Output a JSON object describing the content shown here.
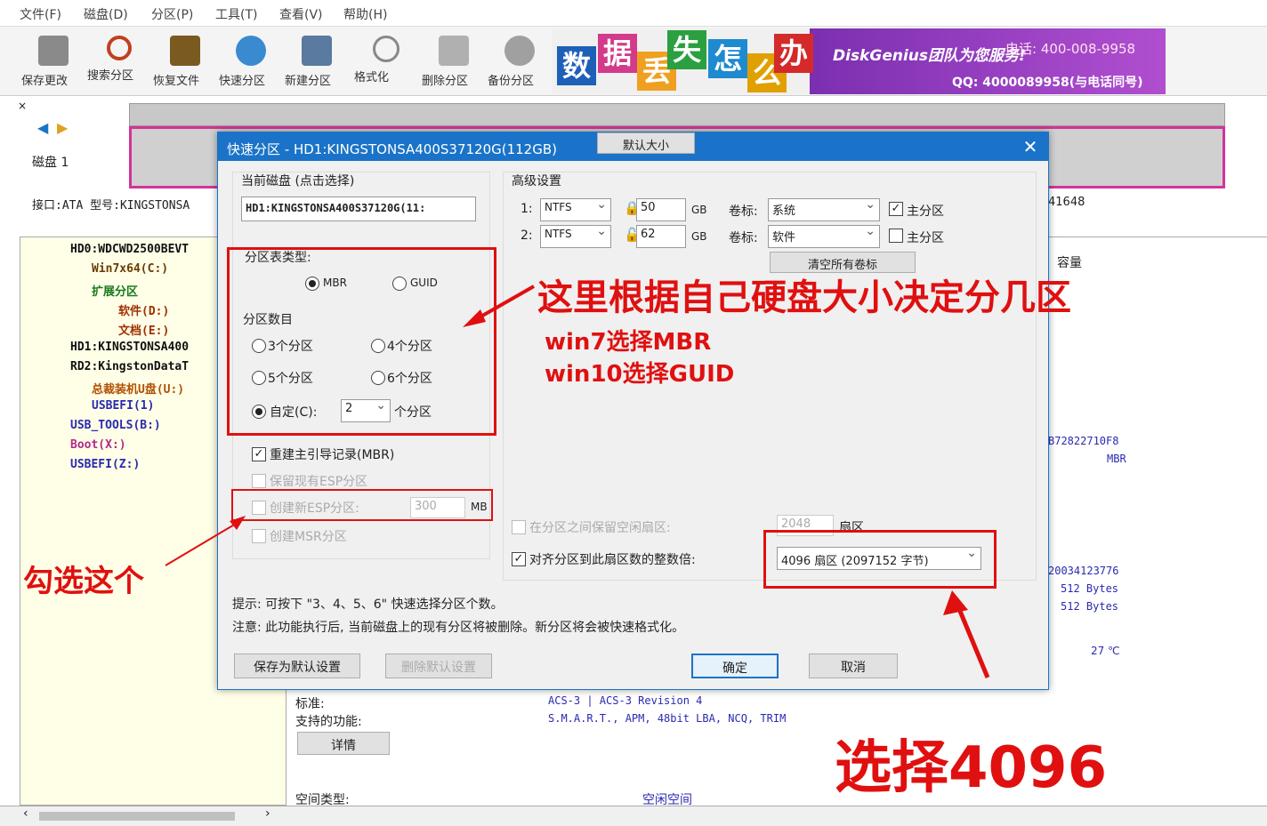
{
  "menu": [
    "文件(F)",
    "磁盘(D)",
    "分区(P)",
    "工具(T)",
    "查看(V)",
    "帮助(H)"
  ],
  "toolbar": [
    {
      "label": "保存更改",
      "icon": "save-icon"
    },
    {
      "label": "搜索分区",
      "icon": "search-icon"
    },
    {
      "label": "恢复文件",
      "icon": "recover-icon"
    },
    {
      "label": "快速分区",
      "icon": "quick-partition-icon"
    },
    {
      "label": "新建分区",
      "icon": "new-partition-icon"
    },
    {
      "label": "格式化",
      "icon": "format-icon"
    },
    {
      "label": "删除分区",
      "icon": "delete-icon"
    },
    {
      "label": "备份分区",
      "icon": "backup-icon"
    }
  ],
  "banner": {
    "chars": [
      "数",
      "据",
      "丢",
      "失",
      "怎",
      "么",
      "办"
    ],
    "brand": "DiskGenius团队为您服务!",
    "phone": "电话: 400-008-9958",
    "qq": "QQ: 4000089958(与电话同号)"
  },
  "disk": {
    "label": "磁盘 1",
    "info": "接口:ATA  型号:KINGSTONSA",
    "right_num": "41648"
  },
  "tree": [
    "HD0:WDCWD2500BEVT",
    "Win7x64(C:)",
    "扩展分区",
    "软件(D:)",
    "文档(E:)",
    "HD1:KINGSTONSA400",
    "RD2:KingstonDataT",
    "总裁装机U盘(U:)",
    "USBEFI(1)",
    "USB_TOOLS(B:)",
    "Boot(X:)",
    "USBEFI(Z:)"
  ],
  "right_panel": {
    "capacity_header": "容量",
    "guid": "B72822710F8",
    "mbr": "MBR",
    "serial": "20034123776",
    "bytes1": "512 Bytes",
    "bytes2": "512 Bytes",
    "temp": "27 ℃",
    "std_label": "标准:",
    "std_value": "ACS-3 | ACS-3 Revision 4",
    "feat_label": "支持的功能:",
    "feat_value": "S.M.A.R.T., APM, 48bit LBA, NCQ, TRIM",
    "detail_btn": "详情",
    "space_label": "空间类型:",
    "space_value": "空闲空间"
  },
  "dialog": {
    "title": "快速分区 - HD1:KINGSTONSA400S37120G(112GB)",
    "current_disk_label": "当前磁盘 (点击选择)",
    "current_disk_value": "HD1:KINGSTONSA400S37120G(11:",
    "table_type_label": "分区表类型:",
    "mbr": "MBR",
    "guid": "GUID",
    "count_label": "分区数目",
    "opt3": "3个分区",
    "opt4": "4个分区",
    "opt5": "5个分区",
    "opt6": "6个分区",
    "custom": "自定(C):",
    "custom_value": "2",
    "custom_unit": "个分区",
    "rebuild_mbr": "重建主引导记录(MBR)",
    "keep_esp": "保留现有ESP分区",
    "new_esp": "创建新ESP分区:",
    "esp_size": "300",
    "esp_unit": "MB",
    "msr": "创建MSR分区",
    "adv_label": "高级设置",
    "rows": [
      {
        "idx": "1:",
        "fs": "NTFS",
        "size": "50",
        "unit": "GB",
        "vol_label": "卷标:",
        "vol": "系统",
        "primary": "主分区",
        "checked": true
      },
      {
        "idx": "2:",
        "fs": "NTFS",
        "size": "62",
        "unit": "GB",
        "vol_label": "卷标:",
        "vol": "软件",
        "primary": "主分区",
        "checked": false
      }
    ],
    "default_size_btn": "默认大小",
    "clear_labels_btn": "清空所有卷标",
    "reserve_label": "在分区之间保留空闲扇区:",
    "reserve_value": "2048",
    "reserve_unit": "扇区",
    "align_label": "对齐分区到此扇区数的整数倍:",
    "align_value": "4096 扇区 (2097152 字节)",
    "tip1": "提示: 可按下 \"3、4、5、6\" 快速选择分区个数。",
    "tip2": "注意: 此功能执行后, 当前磁盘上的现有分区将被删除。新分区将会被快速格式化。",
    "save_default_btn": "保存为默认设置",
    "del_default_btn": "删除默认设置",
    "ok_btn": "确定",
    "cancel_btn": "取消"
  },
  "annotations": {
    "main": "这里根据自己硬盘大小决定分几区",
    "win7": "win7选择MBR",
    "win10": "win10选择GUID",
    "check_this": "勾选这个",
    "choose4096": "选择4096"
  },
  "colors": {
    "accent": "#1a73c8",
    "annot": "#e01010",
    "banner": "#9b3fc8"
  }
}
